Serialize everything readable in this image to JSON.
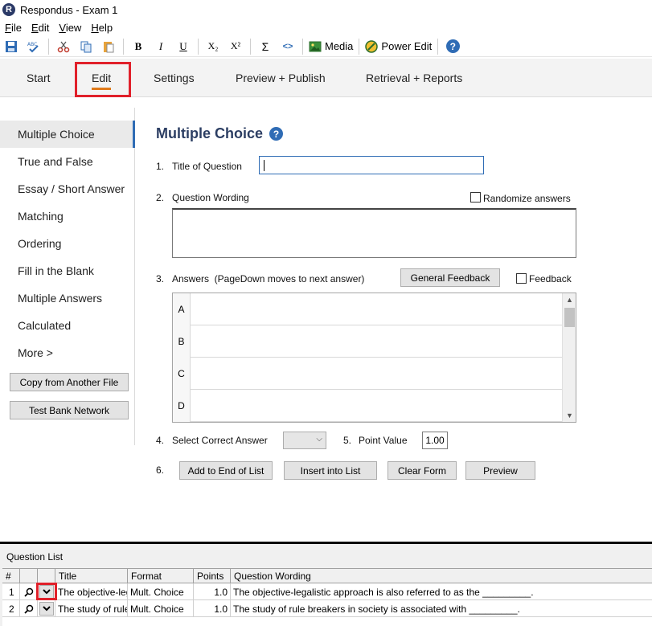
{
  "window": {
    "app_title": "Respondus - Exam 1",
    "logo_letter": "R"
  },
  "menu": [
    {
      "first": "F",
      "rest": "ile"
    },
    {
      "first": "E",
      "rest": "dit"
    },
    {
      "first": "V",
      "rest": "iew"
    },
    {
      "first": "H",
      "rest": "elp"
    }
  ],
  "toolbar": {
    "media_label": "Media",
    "power_edit_label": "Power Edit",
    "bold": "B",
    "italic": "I",
    "underline": "U",
    "subscript": "X₂",
    "superscript": "X²",
    "sigma": "Σ",
    "code": "<>",
    "help": "?"
  },
  "tabs": [
    {
      "label": "Start"
    },
    {
      "label": "Edit"
    },
    {
      "label": "Settings"
    },
    {
      "label": "Preview + Publish"
    },
    {
      "label": "Retrieval + Reports"
    }
  ],
  "sidebar": {
    "items": [
      {
        "label": "Multiple Choice"
      },
      {
        "label": "True and False"
      },
      {
        "label": "Essay / Short Answer"
      },
      {
        "label": "Matching"
      },
      {
        "label": "Ordering"
      },
      {
        "label": "Fill in the Blank"
      },
      {
        "label": "Multiple Answers"
      },
      {
        "label": "Calculated"
      },
      {
        "label": "More >"
      }
    ],
    "copy_button": "Copy from Another File",
    "test_bank_button": "Test Bank Network"
  },
  "form": {
    "heading": "Multiple Choice",
    "help": "?",
    "step1_num": "1.",
    "step1_label": "Title of Question",
    "step2_num": "2.",
    "step2_label": "Question Wording",
    "randomize_label": "Randomize answers",
    "step3_num": "3.",
    "step3_label": "Answers  (PageDown moves to next answer)",
    "general_feedback_button": "General Feedback",
    "feedback_label": "Feedback",
    "answer_letters": [
      "A",
      "B",
      "C",
      "D"
    ],
    "step4_num": "4.",
    "step4_label": "Select Correct Answer",
    "step5_num": "5.",
    "step5_label": "Point Value",
    "point_value": "1.00",
    "step6_num": "6.",
    "add_button": "Add to End of List",
    "insert_button": "Insert into List",
    "clear_button": "Clear Form",
    "preview_button": "Preview"
  },
  "question_list": {
    "label": "Question List",
    "headers": [
      "#",
      "Title",
      "Format",
      "Points",
      "Question Wording"
    ],
    "rows": [
      {
        "num": "1",
        "title": "The objective-leg",
        "format": "Mult. Choice",
        "points": "1.0",
        "wording": "The objective-legalistic approach is also referred to as the _________."
      },
      {
        "num": "2",
        "title": "The study of rule",
        "format": "Mult. Choice",
        "points": "1.0",
        "wording": "The study of rule breakers in society is associated with _________."
      }
    ]
  },
  "colors": {
    "accent": "#2f6cb5",
    "highlight": "#e0202a",
    "tab_underline": "#e07a1a"
  }
}
